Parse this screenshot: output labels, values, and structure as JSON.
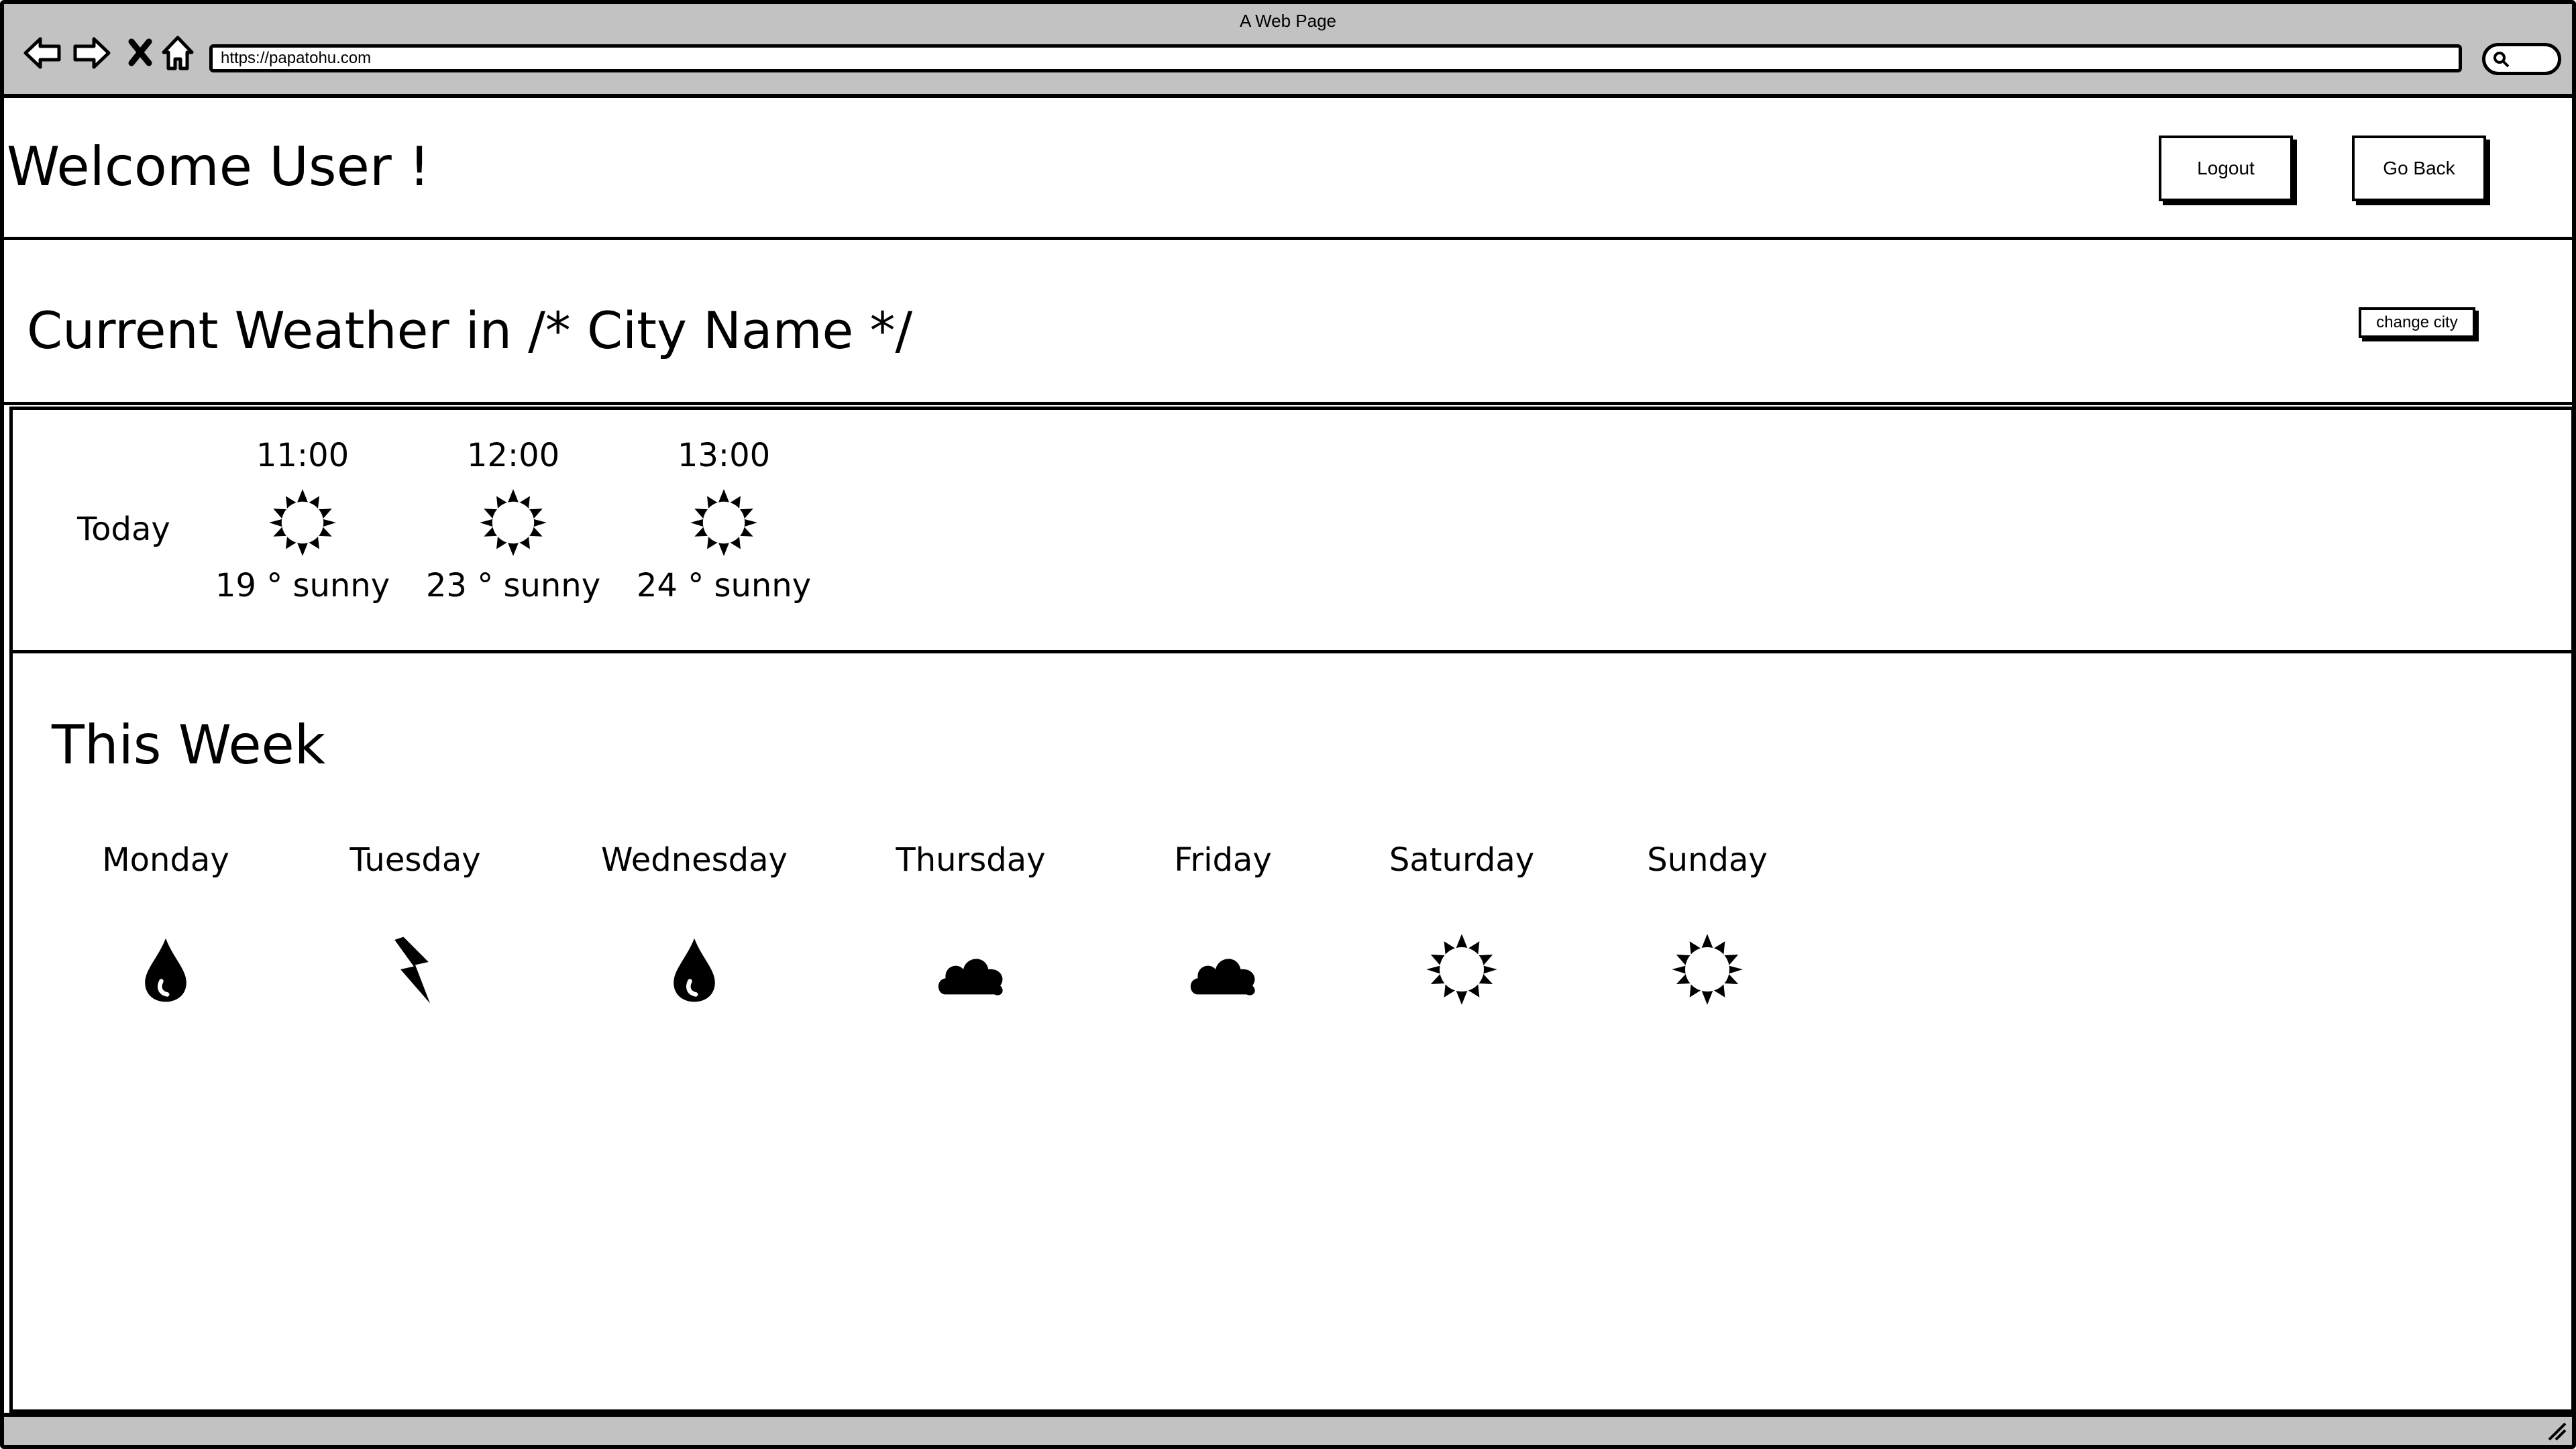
{
  "window": {
    "title": "A Web Page",
    "url": "https://papatohu.com"
  },
  "header": {
    "welcome": "Welcome User !",
    "logout_label": "Logout",
    "goback_label": "Go Back"
  },
  "current": {
    "title": "Current Weather in /* City Name */",
    "change_city_label": "change city"
  },
  "today": {
    "label": "Today",
    "hours": [
      {
        "time": "11:00",
        "desc": "19 ° sunny",
        "icon": "sun-icon"
      },
      {
        "time": "12:00",
        "desc": "23 ° sunny",
        "icon": "sun-icon"
      },
      {
        "time": "13:00",
        "desc": "24 ° sunny",
        "icon": "sun-icon"
      }
    ]
  },
  "week": {
    "title": "This Week",
    "days": [
      {
        "name": "Monday",
        "icon": "raindrop-icon"
      },
      {
        "name": "Tuesday",
        "icon": "lightning-icon"
      },
      {
        "name": "Wednesday",
        "icon": "raindrop-icon"
      },
      {
        "name": "Thursday",
        "icon": "cloud-icon"
      },
      {
        "name": "Friday",
        "icon": "cloud-icon"
      },
      {
        "name": "Saturday",
        "icon": "sun-icon"
      },
      {
        "name": "Sunday",
        "icon": "sun-icon"
      }
    ]
  }
}
